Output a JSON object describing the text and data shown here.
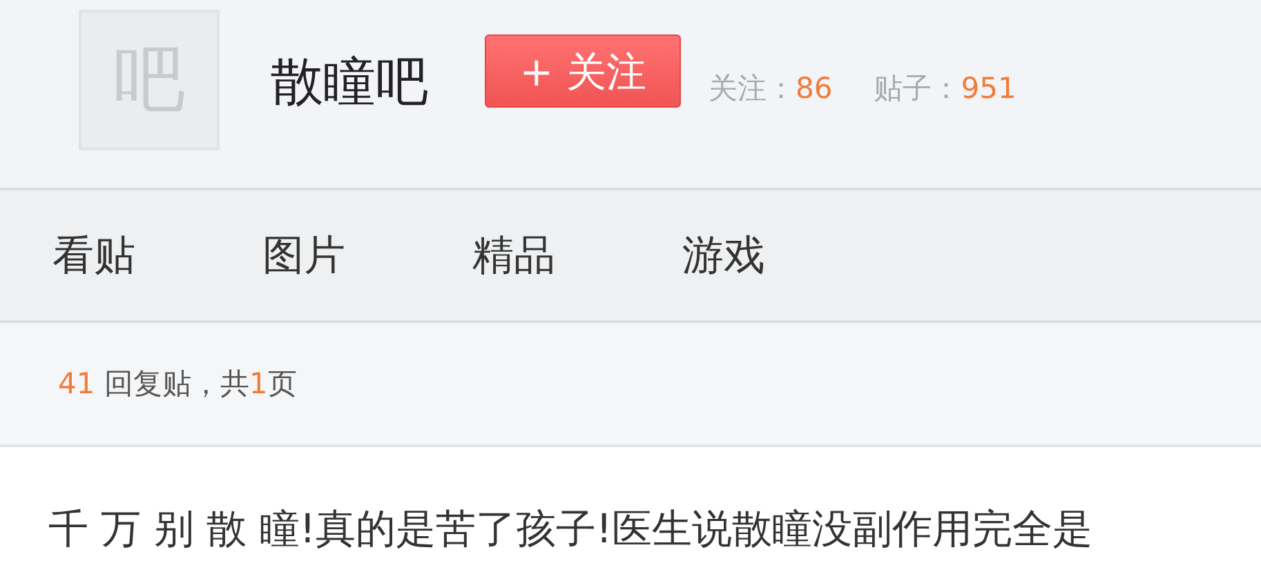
{
  "forum": {
    "avatar_text": "吧",
    "name": "散瞳吧",
    "follow_button": "+ 关注",
    "stats": [
      {
        "label": "关注：",
        "value": "86"
      },
      {
        "label": "贴子：",
        "value": "951"
      }
    ]
  },
  "tabs": [
    {
      "label": "看贴",
      "selected": false
    },
    {
      "label": "图片",
      "selected": false
    },
    {
      "label": "精品",
      "selected": false
    },
    {
      "label": "游戏",
      "selected": false
    }
  ],
  "reply_summary": {
    "count": "41",
    "text_1": " 回复贴，共",
    "pages": "1",
    "text_2": "页"
  },
  "post": {
    "title": "千 万 别 散 瞳!真的是苦了孩子!医生说散瞳没副作用完全是"
  }
}
